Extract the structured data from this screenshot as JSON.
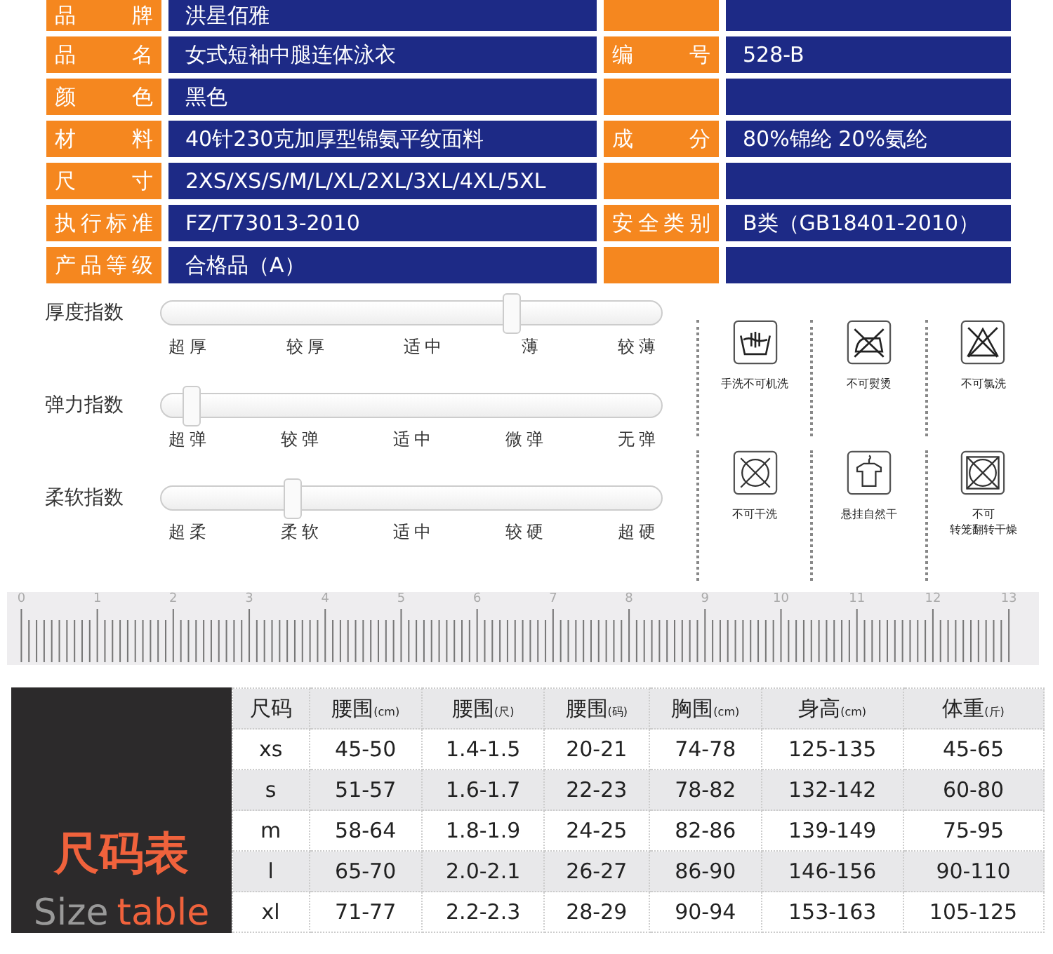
{
  "spec_table": [
    {
      "label": "品牌",
      "value": "洪星佰雅"
    },
    {
      "label": "品名",
      "value": "女式短袖中腿连体泳衣",
      "label2": "编号",
      "value2": "528-B"
    },
    {
      "label": "颜色",
      "value": "黑色"
    },
    {
      "label": "材料",
      "value": "40针230克加厚型锦氨平纹面料",
      "label2": "成分",
      "value2": "80%锦纶 20%氨纶"
    },
    {
      "label": "尺寸",
      "value": "2XS/XS/S/M/L/XL/2XL/3XL/4XL/5XL"
    },
    {
      "label": "执行标准",
      "value": "FZ/T73013-2010",
      "label2": "安全类别",
      "value2": "B类（GB18401-2010）"
    },
    {
      "label": "产品等级",
      "value": "合格品（A）"
    }
  ],
  "indices": [
    {
      "name": "厚度指数",
      "level": 0.7,
      "scale": [
        "超厚",
        "较厚",
        "适中",
        "薄",
        "较薄"
      ]
    },
    {
      "name": "弹力指数",
      "level": 0.06,
      "scale": [
        "超弹",
        "较弹",
        "适中",
        "微弹",
        "无弹"
      ]
    },
    {
      "name": "柔软指数",
      "level": 0.26,
      "scale": [
        "超柔",
        "柔软",
        "适中",
        "较硬",
        "超硬"
      ]
    }
  ],
  "care": [
    {
      "kind": "handwash",
      "lines": [
        "手洗不可机洗"
      ]
    },
    {
      "kind": "no-iron",
      "lines": [
        "不可熨烫"
      ]
    },
    {
      "kind": "no-bleach",
      "lines": [
        "不可氯洗"
      ]
    },
    {
      "kind": "no-dryclean",
      "lines": [
        "不可干洗"
      ]
    },
    {
      "kind": "hang-dry",
      "lines": [
        "悬挂自然干"
      ]
    },
    {
      "kind": "no-tumble",
      "lines": [
        "不可",
        "转笼翻转干燥"
      ]
    }
  ],
  "ruler": {
    "marks": [
      "0",
      "1",
      "2",
      "3",
      "4",
      "5",
      "6",
      "7",
      "8",
      "9",
      "10",
      "11",
      "12",
      "13"
    ]
  },
  "size_table": {
    "title": "尺码表",
    "subtitle_gray": "Size",
    "subtitle_accent": "table",
    "columns": [
      {
        "name": "尺码"
      },
      {
        "name": "腰围",
        "unit": "(cm)"
      },
      {
        "name": "腰围",
        "unit": "(尺)"
      },
      {
        "name": "腰围",
        "unit": "(码)"
      },
      {
        "name": "胸围",
        "unit": "(cm)"
      },
      {
        "name": "身高",
        "unit": "(cm)"
      },
      {
        "name": "体重",
        "unit": "(斤)"
      }
    ],
    "rows": [
      [
        "xs",
        "45-50",
        "1.4-1.5",
        "20-21",
        "74-78",
        "125-135",
        "45-65"
      ],
      [
        "s",
        "51-57",
        "1.6-1.7",
        "22-23",
        "78-82",
        "132-142",
        "60-80"
      ],
      [
        "m",
        "58-64",
        "1.8-1.9",
        "24-25",
        "82-86",
        "139-149",
        "75-95"
      ],
      [
        "l",
        "65-70",
        "2.0-2.1",
        "26-27",
        "86-90",
        "146-156",
        "90-110"
      ],
      [
        "xl",
        "71-77",
        "2.2-2.3",
        "28-29",
        "90-94",
        "153-163",
        "105-125"
      ]
    ]
  }
}
